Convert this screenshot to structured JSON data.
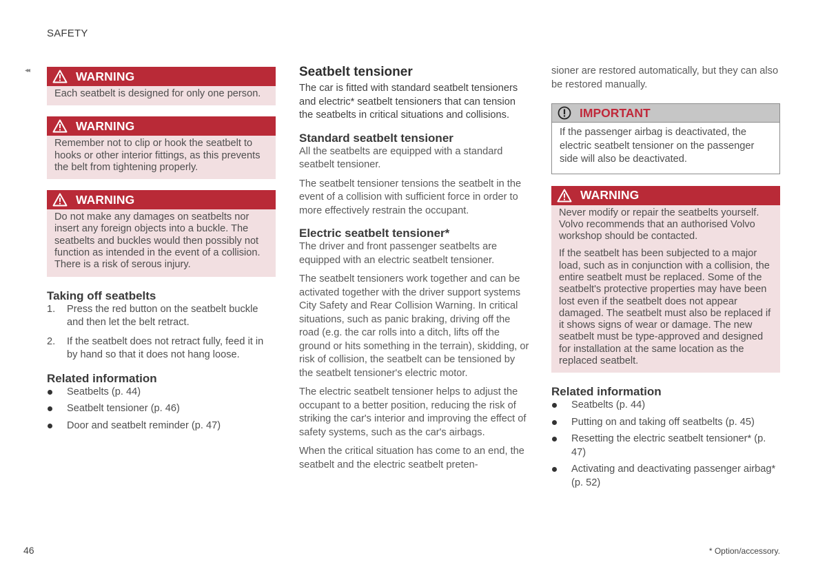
{
  "header": {
    "title": "SAFETY",
    "back_marker": "◂◂"
  },
  "column1": {
    "warnings": [
      {
        "label": "WARNING",
        "paragraphs": [
          "Each seatbelt is designed for only one person."
        ]
      },
      {
        "label": "WARNING",
        "paragraphs": [
          "Remember not to clip or hook the seatbelt to hooks or other interior fittings, as this prevents the belt from tightening properly."
        ]
      },
      {
        "label": "WARNING",
        "paragraphs": [
          "Do not make any damages on seatbelts nor insert any foreign objects into a buckle. The seatbelts and buckles would then possibly not function as intended in the event of a collision. There is a risk of serous injury."
        ]
      }
    ],
    "taking_off": {
      "heading": "Taking off seatbelts",
      "steps": [
        {
          "num": "1.",
          "text": "Press the red button on the seatbelt buckle and then let the belt retract."
        },
        {
          "num": "2.",
          "text": "If the seatbelt does not retract fully, feed it in by hand so that it does not hang loose."
        }
      ]
    },
    "related": {
      "heading": "Related information",
      "items": [
        "Seatbelts (p. 44)",
        "Seatbelt tensioner (p. 46)",
        "Door and seatbelt reminder (p. 47)"
      ]
    }
  },
  "column2": {
    "title": "Seatbelt tensioner",
    "intro": "The car is fitted with standard seatbelt tensioners and electric* seatbelt tensioners that can tension the seatbelts in critical situations and collisions.",
    "standard": {
      "heading": "Standard seatbelt tensioner",
      "paragraphs": [
        "All the seatbelts are equipped with a standard seatbelt tensioner.",
        "The seatbelt tensioner tensions the seatbelt in the event of a collision with sufficient force in order to more effectively restrain the occupant."
      ]
    },
    "electric": {
      "heading": "Electric seatbelt tensioner*",
      "paragraphs": [
        "The driver and front passenger seatbelts are equipped with an electric seatbelt tensioner.",
        "The seatbelt tensioners work together and can be activated together with the driver support systems City Safety and Rear Collision Warning. In critical situations, such as panic braking, driving off the road (e.g. the car rolls into a ditch, lifts off the ground or hits something in the terrain), skidding, or risk of collision, the seatbelt can be tensioned by the seatbelt tensioner's electric motor.",
        "The electric seatbelt tensioner helps to adjust the occupant to a better position, reducing the risk of striking the car's interior and improving the effect of safety systems, such as the car's airbags.",
        "When the critical situation has come to an end, the seatbelt and the electric seatbelt preten-"
      ]
    }
  },
  "column3": {
    "continuation": "sioner are restored automatically, but they can also be restored manually.",
    "important": {
      "label": "IMPORTANT",
      "text": "If the passenger airbag is deactivated, the electric seatbelt tensioner on the passenger side will also be deactivated."
    },
    "warning": {
      "label": "WARNING",
      "paragraphs": [
        "Never modify or repair the seatbelts yourself. Volvo recommends that an authorised Volvo workshop should be contacted.",
        "If the seatbelt has been subjected to a major load, such as in conjunction with a collision, the entire seatbelt must be replaced. Some of the seatbelt's protective properties may have been lost even if the seatbelt does not appear damaged. The seatbelt must also be replaced if it shows signs of wear or damage. The new seatbelt must be type-approved and designed for installation at the same location as the replaced seatbelt."
      ]
    },
    "related": {
      "heading": "Related information",
      "items": [
        "Seatbelts (p. 44)",
        "Putting on and taking off seatbelts (p. 45)",
        "Resetting the electric seatbelt tensioner* (p. 47)",
        "Activating and deactivating passenger airbag* (p. 52)"
      ]
    }
  },
  "footer": {
    "page_number": "46",
    "footnote": "* Option/accessory."
  },
  "colors": {
    "warning_red": "#b92a37",
    "warning_bg": "#f2dfe1",
    "important_gray": "#c6c6c6",
    "important_text": "#c0283a"
  }
}
